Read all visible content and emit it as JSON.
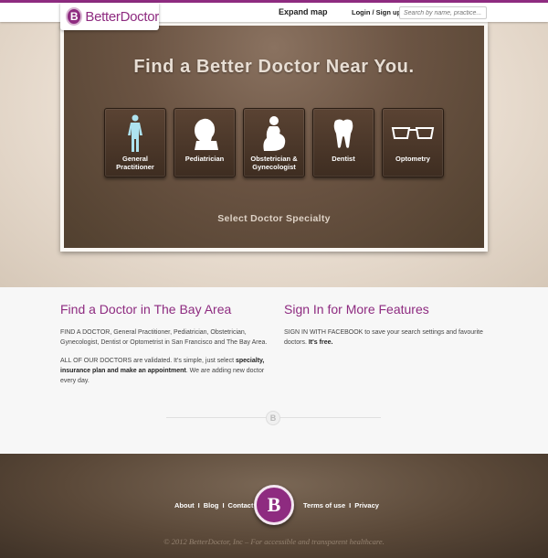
{
  "header": {
    "logo_text": "BetterDoctor",
    "expand_map": "Expand map",
    "login": "Login / Sign up",
    "search_placeholder": "Search by name, practice..."
  },
  "hero": {
    "title": "Find a Better Doctor Near You.",
    "tiles": [
      {
        "label": "General Practitioner",
        "icon": "body-icon"
      },
      {
        "label": "Pediatrician",
        "icon": "child-head-icon"
      },
      {
        "label": "Obstetrician & Gynecologist",
        "icon": "pregnant-woman-icon"
      },
      {
        "label": "Dentist",
        "icon": "tooth-icon"
      },
      {
        "label": "Optometry",
        "icon": "glasses-icon"
      }
    ],
    "select_label": "Select Doctor Specialty"
  },
  "info": {
    "left_title": "Find a Doctor in The Bay Area",
    "left_p1": "FIND A DOCTOR, General Practitioner, Pediatrician, Obstetrician, Gynecologist, Dentist or Optometrist in San Francisco and The Bay Area.",
    "left_p2_a": "ALL OF OUR DOCTORS are validated. It's simple, just select ",
    "left_p2_b": "specialty, insurance plan and make an appointment",
    "left_p2_c": ". We are adding new doctor every day.",
    "right_title": "Sign In for More Features",
    "right_p_a": "SIGN IN WITH FACEBOOK to save your search settings and favourite doctors. ",
    "right_p_b": "It's free."
  },
  "footer": {
    "about": "About",
    "blog": "Blog",
    "contact": "Contact",
    "terms": "Terms of use",
    "privacy": "Privacy",
    "sep": "I",
    "copyright": "© 2012 BetterDoctor, Inc   –   For accessible and transparent healthcare."
  },
  "colors": {
    "brand": "#8e2b80",
    "panel_brown": "#6b5443"
  }
}
